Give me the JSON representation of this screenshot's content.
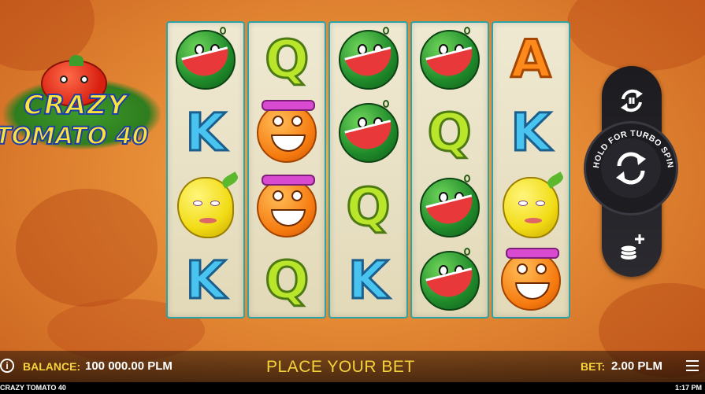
{
  "logo": {
    "line1": "CRAZY",
    "line2": "TOMATO 40"
  },
  "reels": [
    [
      "watermelon",
      "K",
      "lemon",
      "K"
    ],
    [
      "Q",
      "orange",
      "orange",
      "Q"
    ],
    [
      "watermelon",
      "watermelon",
      "Q",
      "K"
    ],
    [
      "watermelon",
      "Q",
      "watermelon",
      "watermelon"
    ],
    [
      "A",
      "K",
      "lemon",
      "orange"
    ]
  ],
  "controls": {
    "autoplay_icon": "autoplay-refresh-icon",
    "spin_icon": "spin-refresh-icon",
    "turbo_label": "HOLD FOR TURBO SPIN",
    "coins_icon": "coins-plus-icon"
  },
  "bottom_bar": {
    "info_icon": "info-icon",
    "balance_label": "BALANCE:",
    "balance_value": "100 000.00 PLM",
    "message": "PLACE YOUR BET",
    "bet_label": "BET:",
    "bet_value": "2.00 PLM",
    "menu_icon": "hamburger-menu-icon"
  },
  "status_bar": {
    "game_name": "CRAZY TOMATO 40",
    "clock": "1:17 PM"
  },
  "colors": {
    "accent_yellow": "#f6d23c",
    "reel_border": "#2ca3a6",
    "control_dark": "#1d1c21"
  }
}
